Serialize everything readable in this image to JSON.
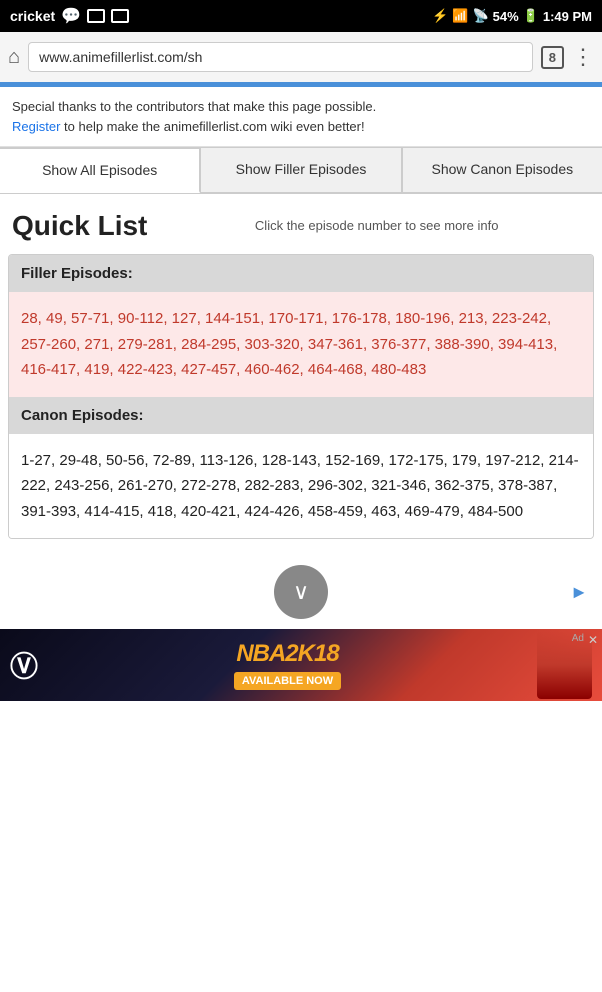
{
  "statusBar": {
    "carrier": "cricket",
    "time": "1:49 PM",
    "battery": "54%",
    "signal": "▲▲▲▲",
    "wifi": "WiFi"
  },
  "browserBar": {
    "url": "www.animefillerlist.com/sh",
    "tabCount": "8"
  },
  "infoBanner": {
    "text": "Special thanks to the contributors that make this page possible.",
    "linkText": "Register",
    "linkSuffix": " to help make the animefillerlist.com wiki even better!"
  },
  "tabs": [
    {
      "label": "Show All Episodes",
      "active": true
    },
    {
      "label": "Show Filler Episodes",
      "active": false
    },
    {
      "label": "Show Canon Episodes",
      "active": false
    }
  ],
  "quickList": {
    "title": "Quick List",
    "hint": "Click the episode number to see more info"
  },
  "fillerSection": {
    "header": "Filler Episodes:",
    "episodes": "28, 49, 57-71, 90-112, 127, 144-151, 170-171, 176-178, 180-196, 213, 223-242, 257-260, 271, 279-281, 284-295, 303-320, 347-361, 376-377, 388-390, 394-413, 416-417, 419, 422-423, 427-457, 460-462, 464-468, 480-483"
  },
  "canonSection": {
    "header": "Canon Episodes:",
    "episodes": "1-27, 29-48, 50-56, 72-89, 113-126, 128-143, 152-169, 172-175, 179, 197-212, 214-222, 243-256, 261-270, 272-278, 282-283, 296-302, 321-346, 362-375, 378-387, 391-393, 414-415, 418, 420-421, 424-426, 458-459, 463, 469-479, 484-500"
  },
  "ad": {
    "label": "Ad",
    "closeIcon": "✕",
    "game": "NBA2K18",
    "available": "AVAILABLE NOW",
    "arrowIcon": "▶"
  },
  "scrollButton": {
    "icon": "∨"
  }
}
